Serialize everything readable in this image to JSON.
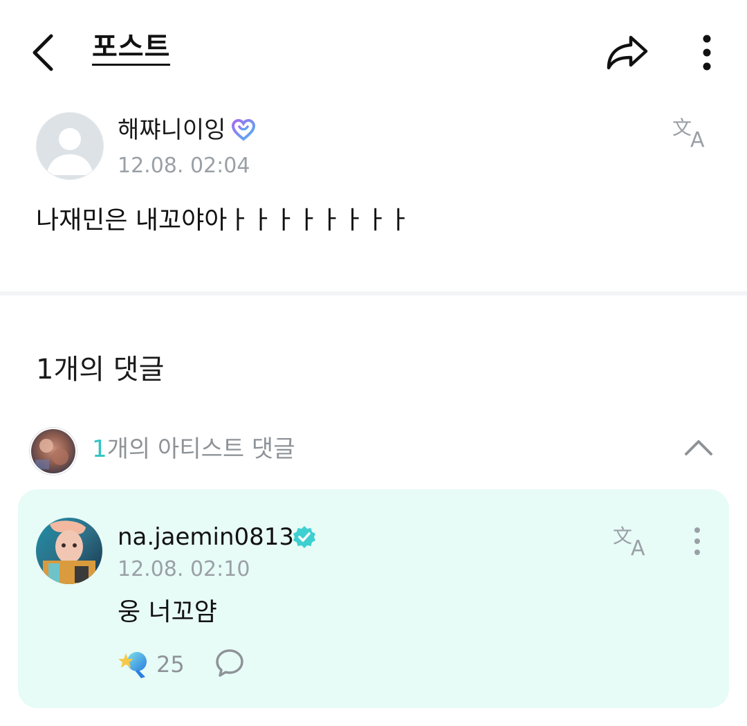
{
  "header": {
    "title": "포스트"
  },
  "post": {
    "author_name": "해쨔니이잉",
    "time": "12.08. 02:04",
    "body": "나재민은 내꼬야아ㅏㅏㅏㅏㅏㅏㅏㅏ"
  },
  "comments": {
    "count_label": "1개의 댓글",
    "artist_header": {
      "count": "1",
      "label": "개의 아티스트 댓글"
    },
    "artist_comment": {
      "username": "na.jaemin0813",
      "time": "12.08. 02:10",
      "text": "웅 너꼬얌",
      "like_count": "25"
    }
  },
  "colors": {
    "accent_teal": "#2fc3c3",
    "card_bg": "#e7fbf7",
    "muted_text": "#9aa0a6"
  },
  "icons": [
    "back-icon",
    "share-icon",
    "more-vertical-icon",
    "translate-icon",
    "heart-badge-icon",
    "verified-icon",
    "chevron-up-icon",
    "like-icon",
    "comment-icon"
  ]
}
